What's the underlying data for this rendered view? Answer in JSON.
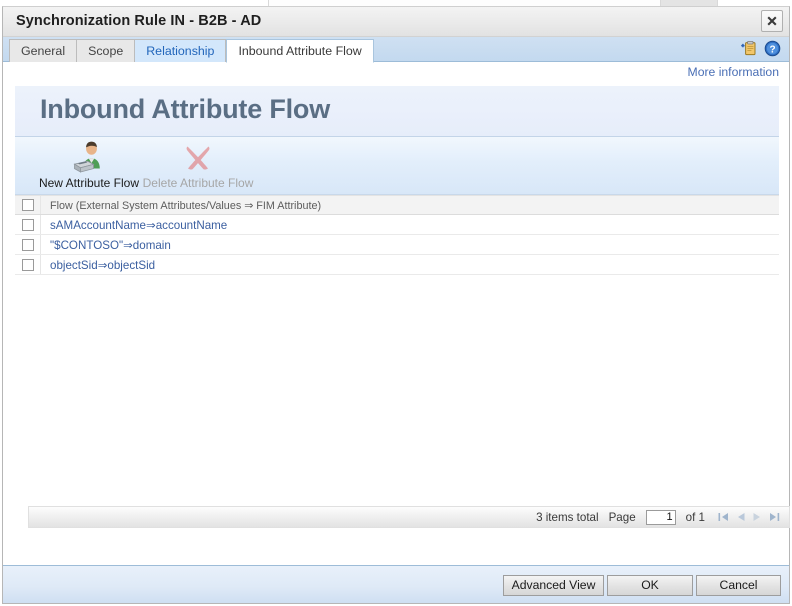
{
  "window": {
    "title": "Synchronization Rule IN - B2B - AD",
    "close_icon": "close-x-icon"
  },
  "tabs": [
    {
      "label": "General",
      "state": "inactive"
    },
    {
      "label": "Scope",
      "state": "inactive"
    },
    {
      "label": "Relationship",
      "state": "hover"
    },
    {
      "label": "Inbound Attribute Flow",
      "state": "active"
    }
  ],
  "tab_icons": [
    {
      "name": "add-clipboard-icon"
    },
    {
      "name": "help-question-icon"
    }
  ],
  "links": {
    "more_information": "More information"
  },
  "panel": {
    "heading": "Inbound Attribute Flow",
    "toolbar": [
      {
        "label": "New Attribute Flow",
        "icon": "new-user-attribute-icon",
        "enabled": true
      },
      {
        "label": "Delete Attribute Flow",
        "icon": "delete-x-icon",
        "enabled": false
      }
    ],
    "grid": {
      "header": {
        "checkbox_checked": false,
        "column": "Flow (External System Attributes/Values ⇒ FIM Attribute)"
      },
      "rows": [
        {
          "checked": false,
          "flow": "sAMAccountName⇒accountName"
        },
        {
          "checked": false,
          "flow": "\"$CONTOSO\"⇒domain"
        },
        {
          "checked": false,
          "flow": "objectSid⇒objectSid"
        }
      ]
    },
    "pager": {
      "items_total": "3 items total",
      "page_label": "Page",
      "page_value": "1",
      "of_label": "of 1",
      "nav": [
        {
          "name": "first-page-icon",
          "enabled": false
        },
        {
          "name": "previous-page-icon",
          "enabled": false
        },
        {
          "name": "next-page-icon",
          "enabled": false
        },
        {
          "name": "last-page-icon",
          "enabled": false
        }
      ]
    }
  },
  "footer": {
    "advanced_view": "Advanced View",
    "ok": "OK",
    "cancel": "Cancel"
  },
  "colors": {
    "accent_blue": "#3b5fa0",
    "tab_bar": "#c3d9ef",
    "heading_gray": "#5a6e84",
    "link_blue": "#4a6fb5"
  }
}
